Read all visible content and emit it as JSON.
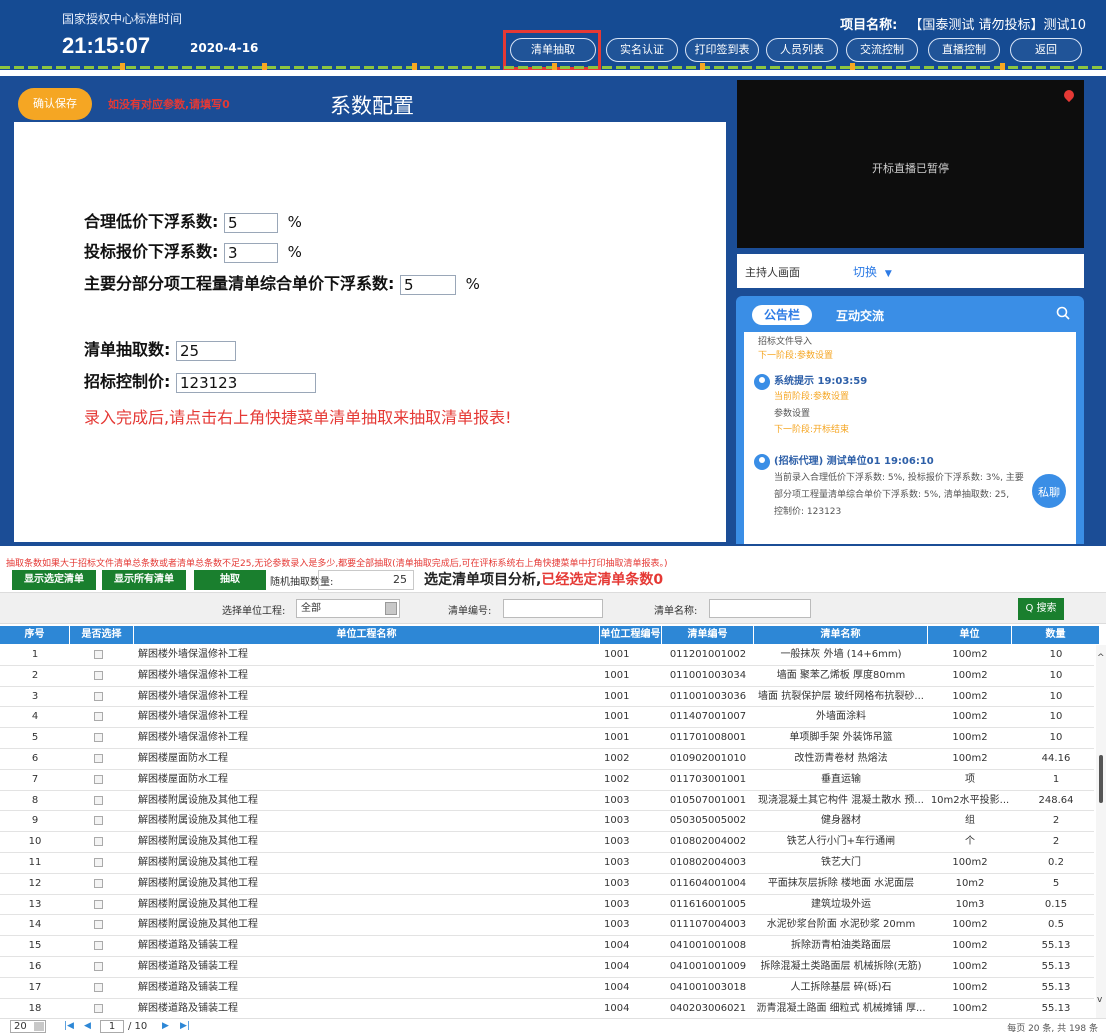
{
  "header": {
    "clock_label": "国家授权中心标准时间",
    "time": "21:15:07",
    "date": "2020-4-16",
    "project_label": "项目名称:",
    "project_value": "【国泰测试 请勿投标】测试10",
    "nav": [
      {
        "label": "清单抽取"
      },
      {
        "label": "实名认证"
      },
      {
        "label": "打印签到表"
      },
      {
        "label": "人员列表"
      },
      {
        "label": "交流控制"
      },
      {
        "label": "直播控制"
      },
      {
        "label": "返回"
      }
    ]
  },
  "config": {
    "confirm_label": "确认保存",
    "warning": "如没有对应参数,请填写0",
    "title": "系数配置",
    "fields": [
      {
        "label": "合理低价下浮系数:",
        "value": "5",
        "unit": "%"
      },
      {
        "label": "投标报价下浮系数:",
        "value": "3",
        "unit": "%"
      },
      {
        "label": "主要分部分项工程量清单综合单价下浮系数:",
        "value": "5",
        "unit": "%"
      },
      {
        "label": "清单抽取数:",
        "value": "25"
      },
      {
        "label": "招标控制价:",
        "value": "123123"
      }
    ],
    "instruction": "录入完成后,请点击右上角快捷菜单清单抽取来抽取清单报表!"
  },
  "live": {
    "status": "开标直播已暂停",
    "host_label": "主持人画面",
    "switch_label": "切换"
  },
  "chat": {
    "tab_notice": "公告栏",
    "tab_interact": "互动交流",
    "lines": [
      "招标文件导入",
      "下一阶段:参数设置",
      "系统提示 19:03:59",
      "当前阶段:参数设置",
      "参数设置",
      "下一阶段:开标结束",
      "(招标代理) 测试单位01 19:06:10",
      "当前录入合理低价下浮系数: 5%, 投标报价下浮系数: 3%, 主要",
      "部分项工程量清单综合单价下浮系数: 5%, 清单抽取数: 25,",
      "控制价: 123123"
    ],
    "private_label": "私聊"
  },
  "list": {
    "notice": "抽取条数如果大于招标文件清单总条数或者清单总条数不足25,无论参数录入是多少,都要全部抽取(清单抽取完成后,可在评标系统右上角快捷菜单中打印抽取清单报表。)",
    "buttons": [
      "显示选定清单",
      "显示所有清单",
      "抽取"
    ],
    "random_label": "随机抽取数量:",
    "random_value": "25",
    "summary_prefix": "选定清单项目分析,",
    "summary_red": "已经选定清单条数0",
    "filter": {
      "unit_label": "选择单位工程:",
      "unit_value": "全部",
      "code_label": "清单编号:",
      "name_label": "清单名称:",
      "search_label": "Q 搜索"
    },
    "columns": [
      "序号",
      "是否选择",
      "单位工程名称",
      "单位工程编号",
      "清单编号",
      "清单名称",
      "单位",
      "数量"
    ],
    "rows": [
      [
        "1",
        "解困楼外墙保温修补工程",
        "1001",
        "011201001002",
        "一般抹灰 外墙 (14+6mm)",
        "100m2",
        "10"
      ],
      [
        "2",
        "解困楼外墙保温修补工程",
        "1001",
        "011001003034",
        "墙面 聚苯乙烯板 厚度80mm",
        "100m2",
        "10"
      ],
      [
        "3",
        "解困楼外墙保温修补工程",
        "1001",
        "011001003036",
        "墙面 抗裂保护层 玻纤网格布抗裂砂...",
        "100m2",
        "10"
      ],
      [
        "4",
        "解困楼外墙保温修补工程",
        "1001",
        "011407001007",
        "外墙面涂料",
        "100m2",
        "10"
      ],
      [
        "5",
        "解困楼外墙保温修补工程",
        "1001",
        "011701008001",
        "单项脚手架 外装饰吊篮",
        "100m2",
        "10"
      ],
      [
        "6",
        "解困楼屋面防水工程",
        "1002",
        "010902001010",
        "改性沥青卷材 热熔法",
        "100m2",
        "44.16"
      ],
      [
        "7",
        "解困楼屋面防水工程",
        "1002",
        "011703001001",
        "垂直运输",
        "项",
        "1"
      ],
      [
        "8",
        "解困楼附属设施及其他工程",
        "1003",
        "010507001001",
        "现浇混凝土其它构件 混凝土散水 预...",
        "10m2水平投影...",
        "248.64"
      ],
      [
        "9",
        "解困楼附属设施及其他工程",
        "1003",
        "050305005002",
        "健身器材",
        "组",
        "2"
      ],
      [
        "10",
        "解困楼附属设施及其他工程",
        "1003",
        "010802004002",
        "铁艺人行小门+车行通闸",
        "个",
        "2"
      ],
      [
        "11",
        "解困楼附属设施及其他工程",
        "1003",
        "010802004003",
        "铁艺大门",
        "100m2",
        "0.2"
      ],
      [
        "12",
        "解困楼附属设施及其他工程",
        "1003",
        "011604001004",
        "平面抹灰层拆除 楼地面 水泥面层",
        "10m2",
        "5"
      ],
      [
        "13",
        "解困楼附属设施及其他工程",
        "1003",
        "011616001005",
        "建筑垃圾外运",
        "10m3",
        "0.15"
      ],
      [
        "14",
        "解困楼附属设施及其他工程",
        "1003",
        "011107004003",
        "水泥砂浆台阶面 水泥砂浆 20mm",
        "100m2",
        "0.5"
      ],
      [
        "15",
        "解困楼道路及铺装工程",
        "1004",
        "041001001008",
        "拆除沥青柏油类路面层",
        "100m2",
        "55.13"
      ],
      [
        "16",
        "解困楼道路及铺装工程",
        "1004",
        "041001001009",
        "拆除混凝土类路面层 机械拆除(无筋)",
        "100m2",
        "55.13"
      ],
      [
        "17",
        "解困楼道路及铺装工程",
        "1004",
        "041001003018",
        "人工拆除基层 碎(砾)石",
        "100m2",
        "55.13"
      ],
      [
        "18",
        "解困楼道路及铺装工程",
        "1004",
        "040203006021",
        "沥青混凝土路面 细粒式 机械摊铺 厚...",
        "100m2",
        "55.13"
      ]
    ],
    "pager": {
      "page_size": "20",
      "current_page": "1",
      "total_pages": "/ 10",
      "info": "每页 20 条, 共 198 条"
    }
  }
}
